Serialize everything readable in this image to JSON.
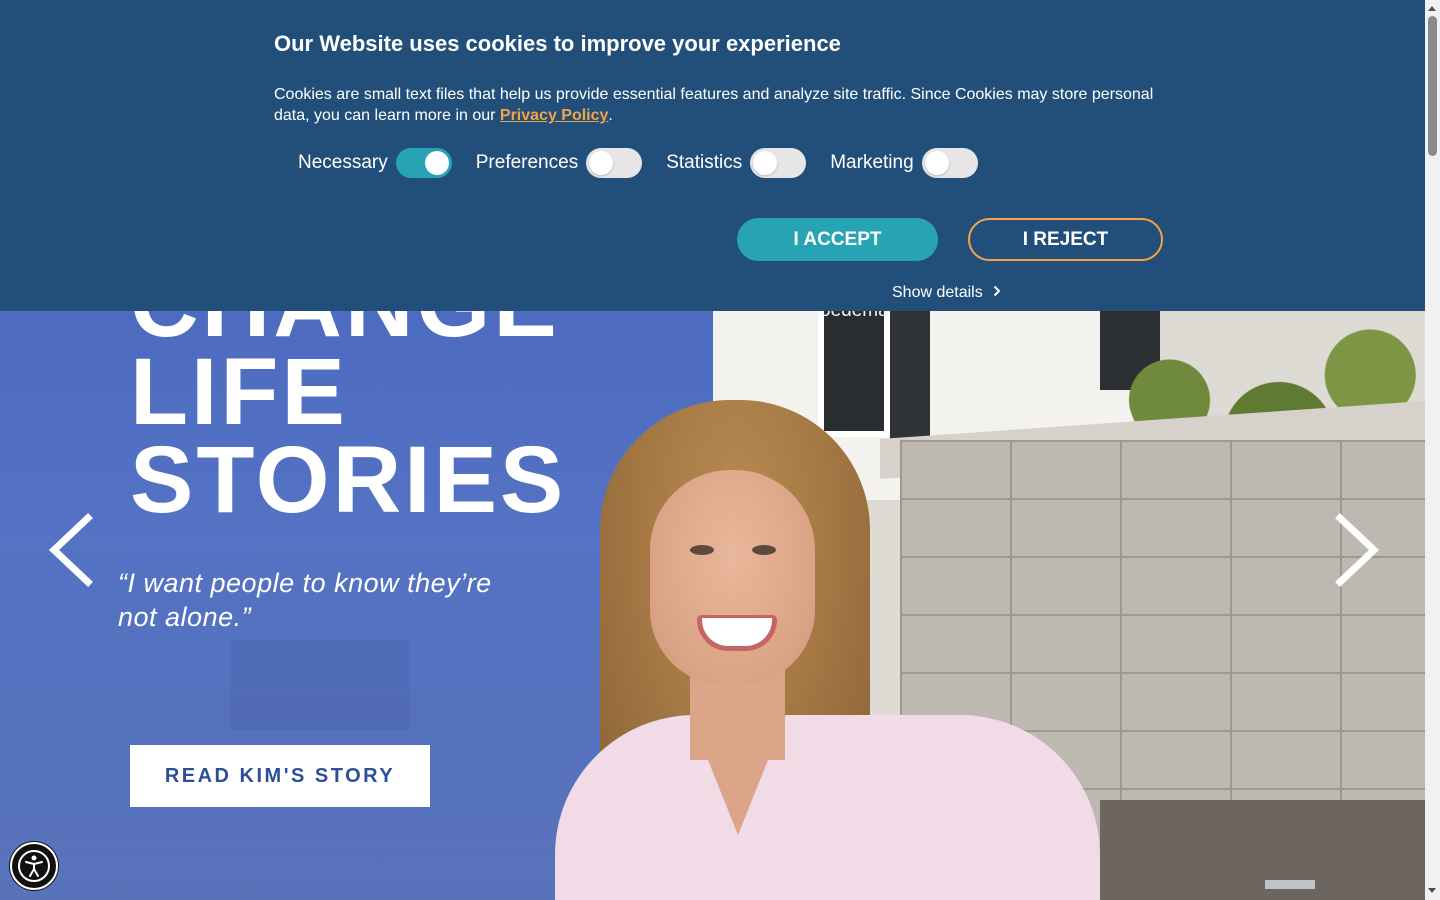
{
  "cookie_banner": {
    "title": "Our Website uses cookies to improve your experience",
    "text_before_link": "Cookies are small text files that help us provide essential features and analyze site traffic. Since Cookies may store personal data, you can learn more in our ",
    "link_label": "Privacy Policy",
    "text_after_link": ".",
    "toggles": [
      {
        "label": "Necessary",
        "state": "on"
      },
      {
        "label": "Preferences",
        "state": "off"
      },
      {
        "label": "Statistics",
        "state": "off"
      },
      {
        "label": "Marketing",
        "state": "off"
      }
    ],
    "accept_label": "I ACCEPT",
    "reject_label": "I REJECT",
    "details_label": "Show details"
  },
  "hero": {
    "title": "CHANGE\nLIFE\nSTORIES",
    "caption": "Angioedema",
    "quote": "“I want people to know they’re not alone.”",
    "cta_label": "READ KIM'S STORY"
  },
  "colors": {
    "banner_bg": "#214f79",
    "accent_teal": "#27a3b4",
    "accent_orange": "#f0a446",
    "hero_blue": "#4d6bc0",
    "cta_text": "#2d4f98"
  },
  "icons": {
    "prev": "chevron-left-icon",
    "next": "chevron-right-icon",
    "details": "chevron-right-icon",
    "accessibility": "accessibility-icon"
  }
}
